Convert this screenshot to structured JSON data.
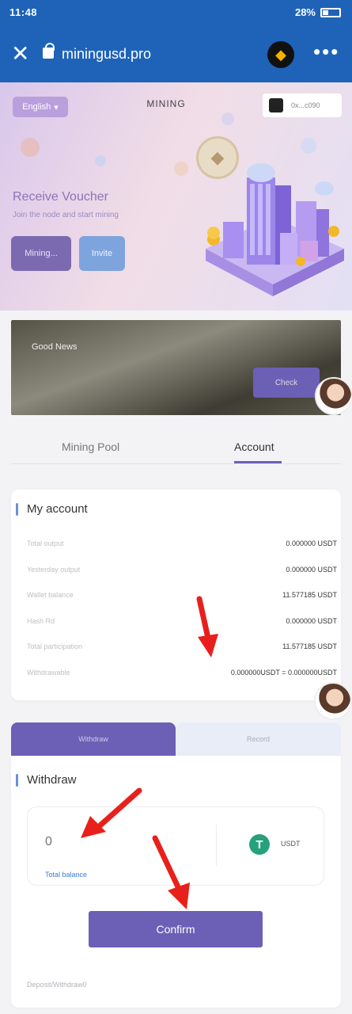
{
  "status_bar": {
    "time": "11:48",
    "battery": "28%"
  },
  "browser": {
    "url": "miningusd.pro",
    "more": "•••"
  },
  "hero": {
    "language": "English",
    "title": "MINING",
    "account_chip": "0x...c090",
    "voucher_title": "Receive Voucher",
    "voucher_subtitle": "Join the node and start mining",
    "mining_button": "Mining...",
    "invite_button": "Invite"
  },
  "news": {
    "title": "Good News",
    "button": "Check"
  },
  "tabs": [
    {
      "label": "Mining Pool"
    },
    {
      "label": "Account"
    }
  ],
  "my_account": {
    "title": "My account",
    "rows": [
      {
        "label": "Total output",
        "value": "0.000000 USDT"
      },
      {
        "label": "Yesterday output",
        "value": "0.000000 USDT"
      },
      {
        "label": "Wallet balance",
        "value": "11.577185 USDT"
      },
      {
        "label": "Hash Rd",
        "value": "0.000000 USDT"
      },
      {
        "label": "Total participation",
        "value": "11.577185 USDT"
      },
      {
        "label": "Withdrawable",
        "value": "0.000000USDT = 0.000000USDT"
      }
    ]
  },
  "segments": {
    "withdraw": "Withdraw",
    "record": "Record"
  },
  "withdraw": {
    "title": "Withdraw",
    "amount_placeholder": "0",
    "total_balance_label": "Total balance",
    "currency": "USDT",
    "confirm": "Confirm",
    "note": "Deposit/Withdraw0"
  },
  "colors": {
    "brand": "#1e63b8",
    "accent": "#6c5fb6",
    "annotation_arrow": "#e8201c",
    "usdt": "#26a17b"
  }
}
